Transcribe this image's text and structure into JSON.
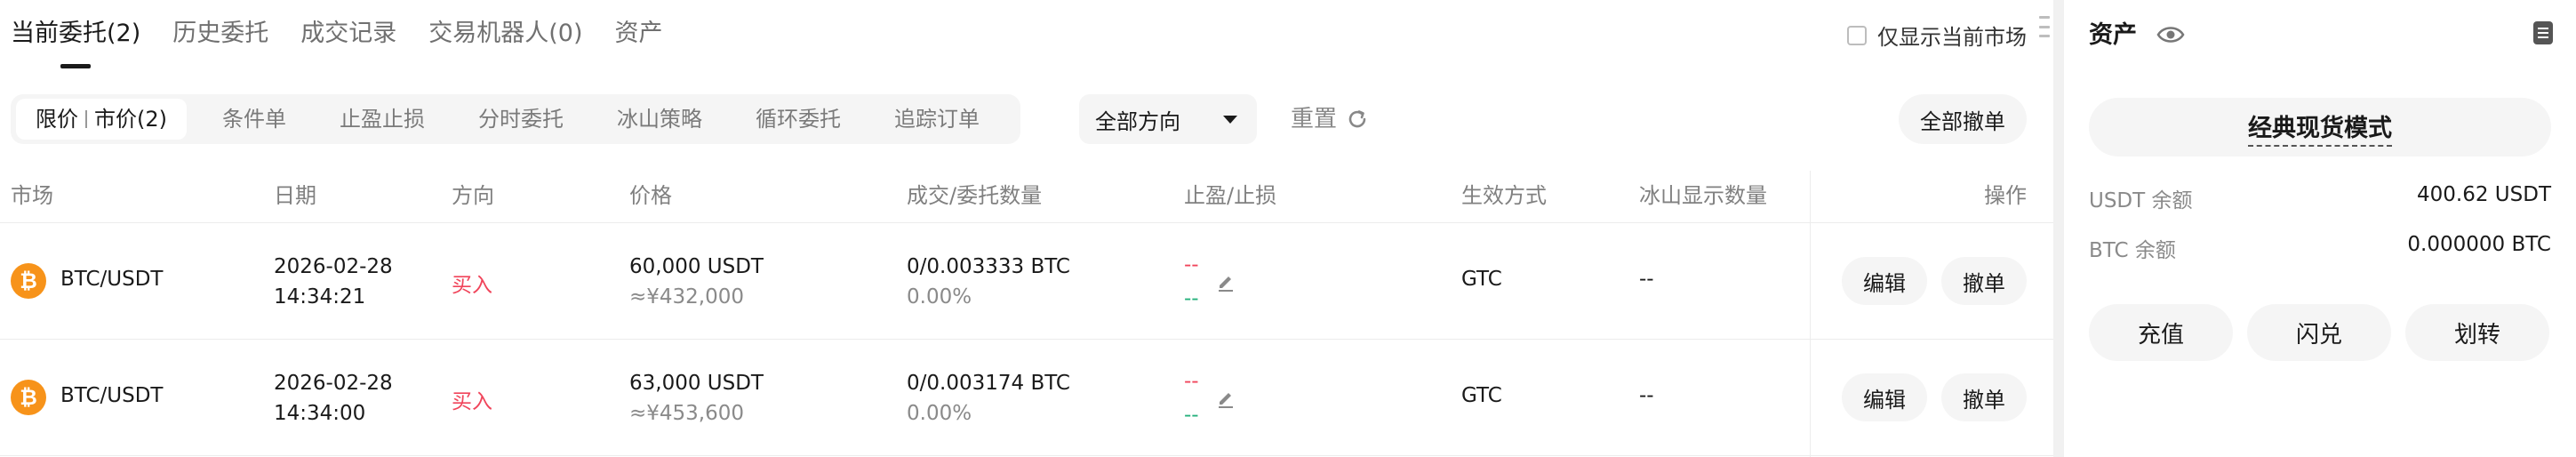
{
  "tabs": [
    {
      "label": "当前委托(2)",
      "active": true
    },
    {
      "label": "历史委托",
      "active": false
    },
    {
      "label": "成交记录",
      "active": false
    },
    {
      "label": "交易机器人(0)",
      "active": false
    },
    {
      "label": "资产",
      "active": false
    }
  ],
  "only_current_market": {
    "label": "仅显示当前市场",
    "checked": false
  },
  "order_types": {
    "active_left": "限价",
    "active_right": "市价(2)",
    "items": [
      "条件单",
      "止盈止损",
      "分时委托",
      "冰山策略",
      "循环委托",
      "追踪订单"
    ]
  },
  "direction_select": {
    "value": "全部方向"
  },
  "reset_label": "重置",
  "cancel_all_label": "全部撤单",
  "columns": {
    "market": "市场",
    "date": "日期",
    "side": "方向",
    "price": "价格",
    "filled": "成交/委托数量",
    "tpsl": "止盈/止损",
    "tif": "生效方式",
    "iceberg": "冰山显示数量",
    "action": "操作"
  },
  "orders": [
    {
      "market": "BTC/USDT",
      "date": "2026-02-28",
      "time": "14:34:21",
      "side": "买入",
      "price": "60,000 USDT",
      "price_cny": "≈¥432,000",
      "filled": "0/0.003333 BTC",
      "filled_pct": "0.00%",
      "tp": "--",
      "sl": "--",
      "tif": "GTC",
      "iceberg": "--",
      "edit_label": "编辑",
      "cancel_label": "撤单"
    },
    {
      "market": "BTC/USDT",
      "date": "2026-02-28",
      "time": "14:34:00",
      "side": "买入",
      "price": "63,000 USDT",
      "price_cny": "≈¥453,600",
      "filled": "0/0.003174 BTC",
      "filled_pct": "0.00%",
      "tp": "--",
      "sl": "--",
      "tif": "GTC",
      "iceberg": "--",
      "edit_label": "编辑",
      "cancel_label": "撤单"
    }
  ],
  "coin_glyph": "₿",
  "assets": {
    "title": "资产",
    "mode_label": "经典现货模式",
    "balances": [
      {
        "label": "USDT 余额",
        "value": "400.62 USDT"
      },
      {
        "label": "BTC 余额",
        "value": "0.000000 BTC"
      }
    ],
    "actions": [
      "充值",
      "闪兑",
      "划转"
    ]
  },
  "colors": {
    "buy": "#f0445a",
    "take_profit": "#f0445a",
    "stop_loss": "#23b07b",
    "btc": "#f7931a"
  },
  "icons": [
    "eye-icon",
    "refresh-icon",
    "pencil-icon",
    "document-icon",
    "bitcoin-icon",
    "chevron-down-icon"
  ]
}
